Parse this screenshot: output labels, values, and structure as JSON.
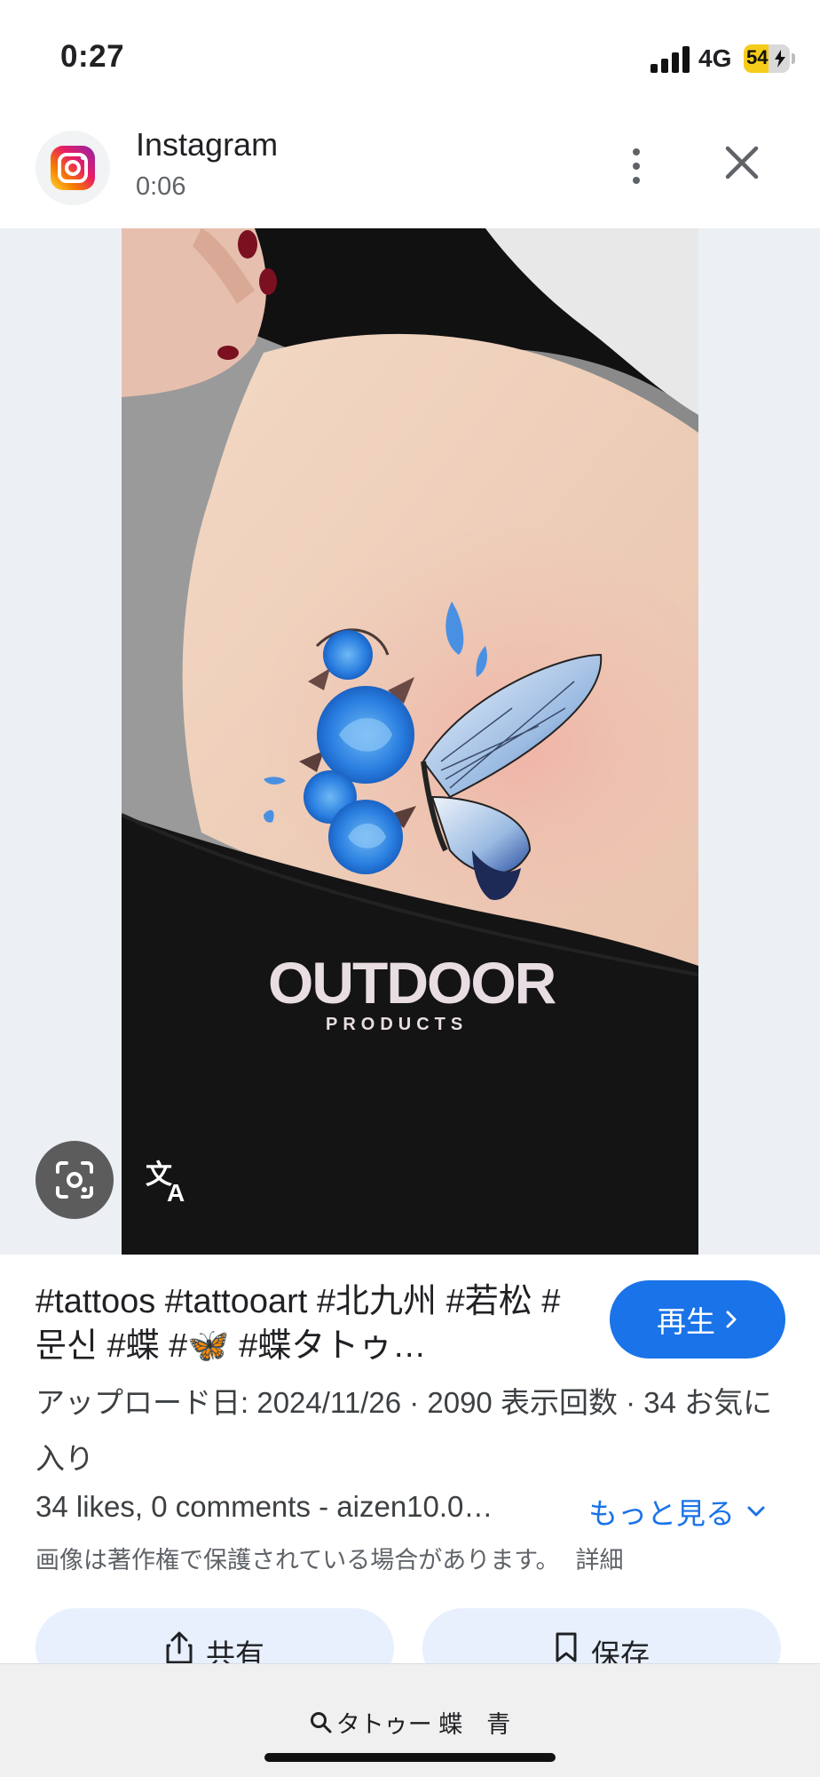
{
  "status_bar": {
    "time": "0:27",
    "network": "4G",
    "battery_level": "54",
    "battery_fraction": 0.54,
    "icons": [
      "signal-icon",
      "battery-charging-icon"
    ]
  },
  "source": {
    "app_name": "Instagram",
    "duration": "0:06",
    "icons": [
      "instagram-icon",
      "more-vert-icon",
      "close-icon"
    ]
  },
  "viewer": {
    "icons": [
      "lens-icon",
      "translate-icon"
    ],
    "photo_overlay_text": "OUTDOOR",
    "photo_overlay_subtext": "PRODUCTS"
  },
  "result": {
    "title": "#tattoos #tattooart #北九州 #若松 #문신 #蝶 #🦋 #蝶タトゥ…",
    "play_label": "再生",
    "meta": "アップロード日: 2024/11/26 · 2090 表示回数 · 34 お気に入り",
    "description": "34 likes, 0 comments - aizen10.0…",
    "more_label": "もっと見る",
    "copyright_note": "画像は著作権で保護されている場合があります。",
    "details_label": "詳細",
    "share_label": "共有",
    "save_label": "保存"
  },
  "search": {
    "query": "タトゥー 蝶　青"
  },
  "colors": {
    "accent": "#1a73e8",
    "chip_bg": "#e8f0fe",
    "battery": "#f5cc1a"
  }
}
